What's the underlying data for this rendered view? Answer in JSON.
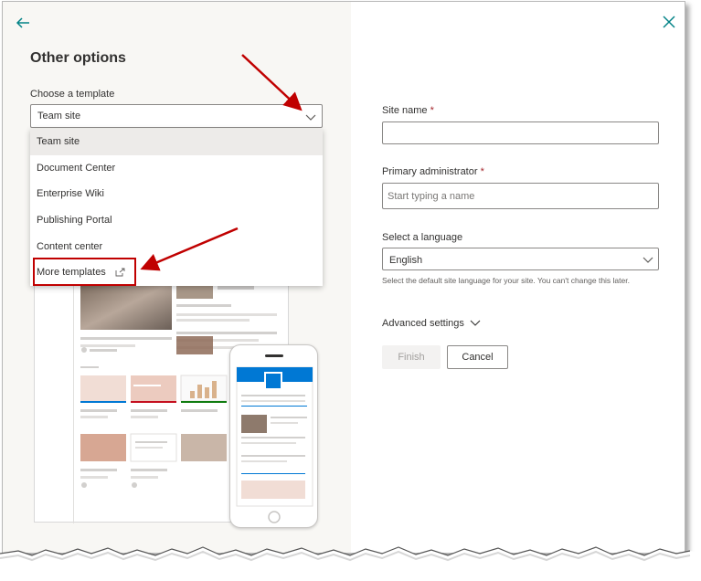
{
  "left_panel": {
    "title": "Other options",
    "template_label": "Choose a template",
    "template_selected": "Team site",
    "template_options": [
      {
        "label": "Team site"
      },
      {
        "label": "Document Center"
      },
      {
        "label": "Enterprise Wiki"
      },
      {
        "label": "Publishing Portal"
      },
      {
        "label": "Content center"
      },
      {
        "label": "More templates"
      }
    ]
  },
  "right_panel": {
    "site_name_label": "Site name",
    "required_mark": "*",
    "site_name_value": "",
    "primary_admin_label": "Primary administrator",
    "primary_admin_placeholder": "Start typing a name",
    "language_label": "Select a language",
    "language_value": "English",
    "language_help": "Select the default site language for your site. You can't change this later.",
    "advanced_settings": "Advanced settings",
    "finish_button": "Finish",
    "cancel_button": "Cancel"
  },
  "colors": {
    "accent": "#0078d4",
    "icon_teal": "#038387",
    "annotation_red": "#c00000",
    "required_red": "#a4262c",
    "panel_bg": "#f8f7f4"
  },
  "icons": [
    "back-arrow-icon",
    "close-icon",
    "chevron-down-icon",
    "external-link-icon"
  ]
}
